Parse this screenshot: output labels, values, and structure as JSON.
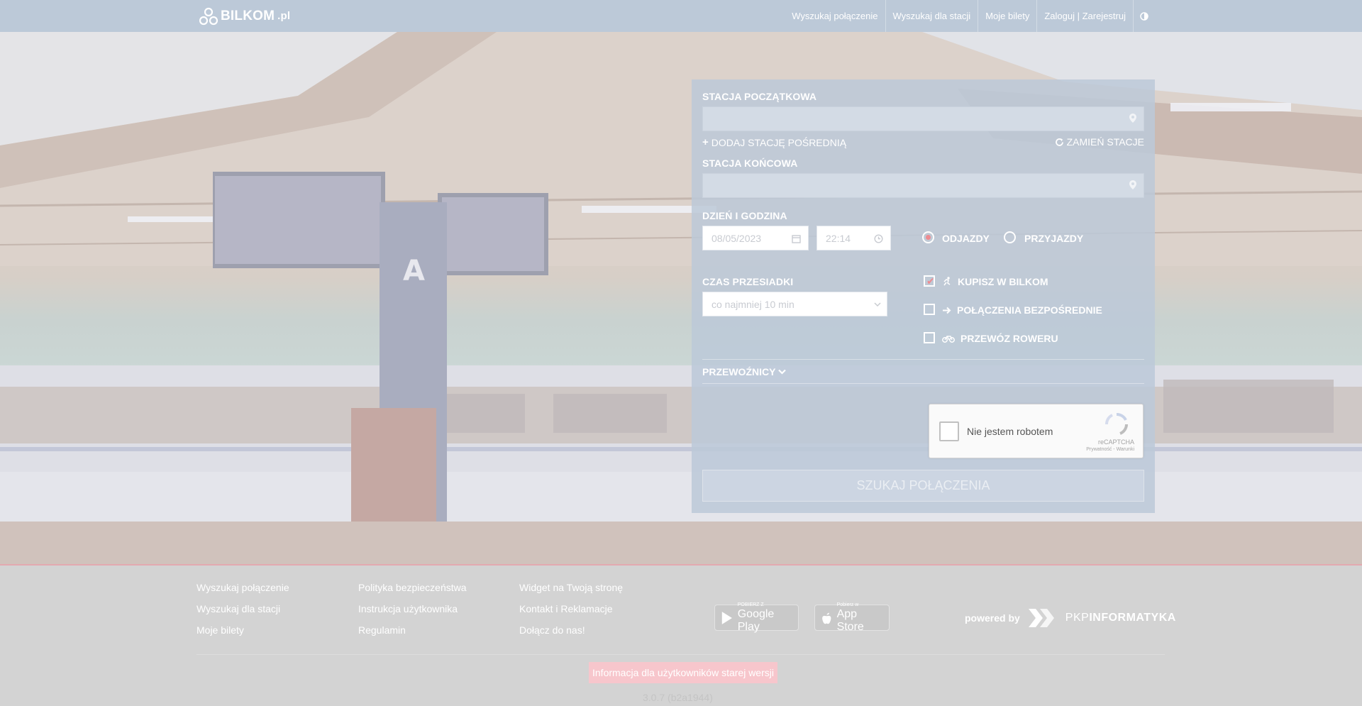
{
  "navbar": {
    "logo_text": "BILKOM",
    "logo_suffix": ".pl",
    "links": [
      "Wyszukaj połączenie",
      "Wyszukaj dla stacji",
      "Moje bilety",
      "Zaloguj | Zarejestruj"
    ]
  },
  "search": {
    "start_label": "STACJA POCZĄTKOWA",
    "start_value": "",
    "add_via": "DODAJ STACJĘ POŚREDNIĄ",
    "swap": "ZAMIEŃ STACJE",
    "end_label": "STACJA KOŃCOWA",
    "end_value": "",
    "datetime_label": "DZIEŃ I GODZINA",
    "date_value": "08/05/2023",
    "time_value": "22:14",
    "departures": "ODJAZDY",
    "arrivals": "PRZYJAZDY",
    "departures_selected": true,
    "transfer_label": "CZAS PRZESIADKI",
    "transfer_value": "co najmniej 10 min",
    "buy_in_bilkom": "KUPISZ W BILKOM",
    "buy_in_bilkom_checked": true,
    "direct": "POŁĄCZENIA BEZPOŚREDNIE",
    "direct_checked": false,
    "bike": "PRZEWÓZ ROWERU",
    "bike_checked": false,
    "carriers": "PRZEWOŹNICY",
    "captcha_text": "Nie jestem robotem",
    "captcha_brand": "reCAPTCHA",
    "captcha_terms": "Prywatność - Warunki",
    "submit": "SZUKAJ POŁĄCZENIA"
  },
  "footer": {
    "col1": [
      "Wyszukaj połączenie",
      "Wyszukaj dla stacji",
      "Moje bilety"
    ],
    "col2": [
      "Polityka bezpieczeństwa",
      "Instrukcja użytkownika",
      "Regulamin"
    ],
    "col3": [
      "Widget na Twoją stronę",
      "Kontakt i Reklamacje",
      "Dołącz do nas!"
    ],
    "google_play_small": "POBIERZ Z",
    "google_play_big": "Google Play",
    "app_store_small": "Pobierz w",
    "app_store_big": "App Store",
    "powered_by": "powered by",
    "pkp_light": "PKP",
    "pkp_bold": "INFORMATYKA",
    "old_version": "Informacja dla użytkowników starej wersji",
    "version": "3.0.7 (b2a1944)"
  },
  "colors": {
    "nav_bg": "#bcc9d8",
    "accent": "#ee8b91",
    "footer_bg": "#d3d3d3"
  }
}
